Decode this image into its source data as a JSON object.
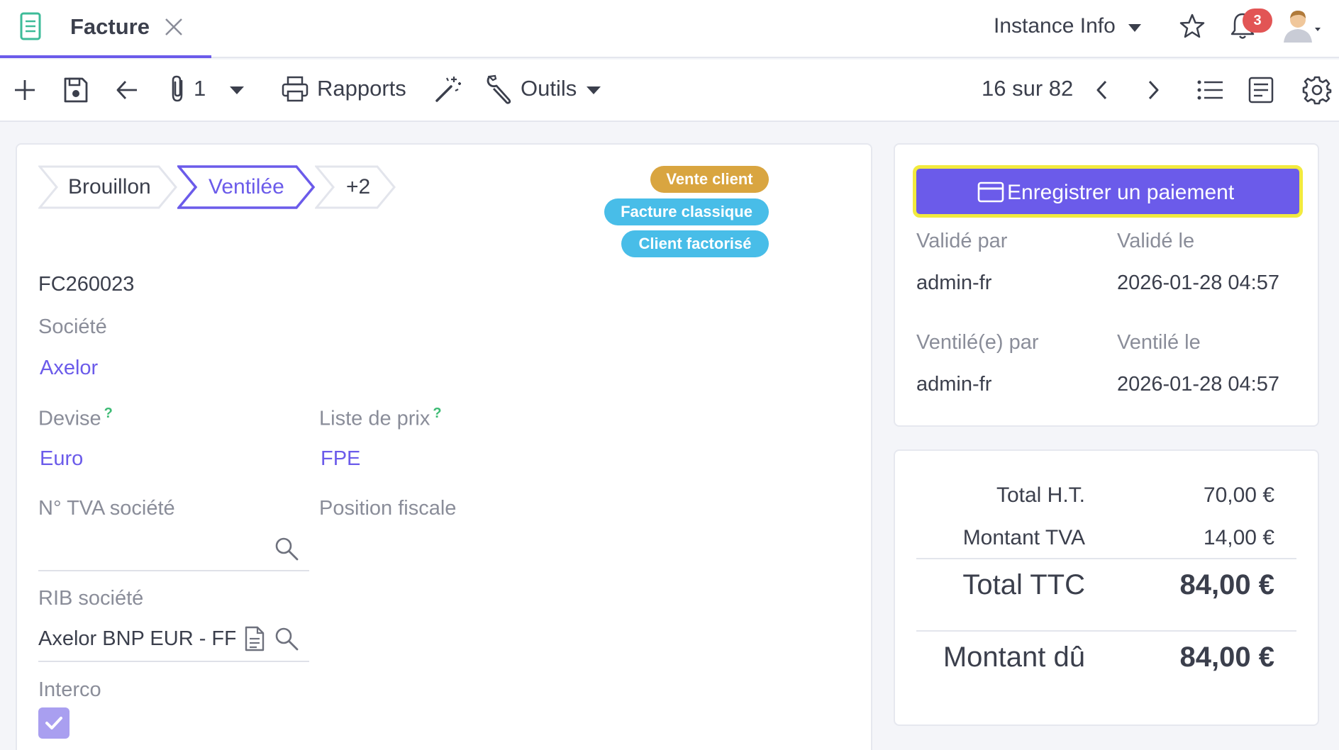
{
  "header": {
    "tab_title": "Facture",
    "instance_info": "Instance Info",
    "notification_count": "3"
  },
  "toolbar": {
    "attachment_count": "1",
    "reports_label": "Rapports",
    "tools_label": "Outils",
    "pager": "16 sur 82"
  },
  "status_steps": [
    {
      "label": "Brouillon",
      "active": false
    },
    {
      "label": "Ventilée",
      "active": true
    },
    {
      "label": "+2",
      "active": false
    }
  ],
  "tags": [
    {
      "label": "Vente client",
      "color": "#d9a540"
    },
    {
      "label": "Facture classique",
      "color": "#48bde8"
    },
    {
      "label": "Client factorisé",
      "color": "#48bde8"
    }
  ],
  "form": {
    "invoice_number": "FC260023",
    "company_label": "Société",
    "company_value": "Axelor",
    "currency_label": "Devise",
    "currency_help": "?",
    "currency_value": "Euro",
    "pricelist_label": "Liste de prix",
    "pricelist_help": "?",
    "pricelist_value": "FPE",
    "company_vat_label": "N° TVA société",
    "company_vat_value": "",
    "fiscal_position_label": "Position fiscale",
    "company_bank_label": "RIB société",
    "company_bank_value": "Axelor BNP EUR - FF",
    "interco_label": "Interco",
    "interco_checked": true
  },
  "payment": {
    "button_label": "Enregistrer un paiement",
    "validated_by_label": "Validé par",
    "validated_on_label": "Validé le",
    "validated_by": "admin-fr",
    "validated_on": "2026-01-28 04:57",
    "ventilated_by_label": "Ventilé(e) par",
    "ventilated_on_label": "Ventilé le",
    "ventilated_by": "admin-fr",
    "ventilated_on": "2026-01-28 04:57"
  },
  "totals": {
    "total_ht_label": "Total H.T.",
    "total_ht_value": "70,00 €",
    "tva_label": "Montant TVA",
    "tva_value": "14,00 €",
    "total_ttc_label": "Total TTC",
    "total_ttc_value": "84,00 €",
    "amount_due_label": "Montant dû",
    "amount_due_value": "84,00 €"
  },
  "colors": {
    "accent": "#6b5bea",
    "highlight": "#f2ea3e",
    "success": "#3dbb74",
    "danger": "#e25555"
  }
}
